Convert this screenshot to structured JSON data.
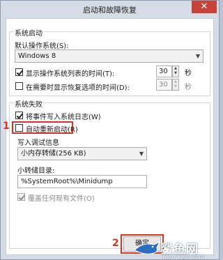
{
  "window": {
    "title": "启动和故障恢复",
    "close_icon": "close-icon"
  },
  "system_startup": {
    "group_title": "系统启动",
    "default_os_label": "默认操作系统(S):",
    "default_os_value": "Windows 8",
    "show_os_list_label": "显示操作系统列表的时间(T):",
    "show_os_list_checked": true,
    "show_os_list_value": "30",
    "show_os_list_unit": "秒",
    "show_recovery_label": "在需要时显示恢复选项的时间(D):",
    "show_recovery_checked": false,
    "show_recovery_value": "30",
    "show_recovery_unit": "秒"
  },
  "system_failure": {
    "group_title": "系统失败",
    "write_event_label": "将事件写入系统日志(W)",
    "write_event_checked": true,
    "auto_restart_label": "自动重新启动(R)",
    "auto_restart_checked": false,
    "debug_info": {
      "group_title": "写入调试信息",
      "dump_type": "小内存转储(256 KB)",
      "dump_dir_label": "小转储目录:",
      "dump_dir_value": "%SystemRoot%\\Minidump",
      "overwrite_label": "覆盖任何现有文件(O)",
      "overwrite_checked": true
    }
  },
  "annotations": {
    "marker_1": "1",
    "marker_2": "2",
    "color": "#e0311f"
  },
  "buttons": {
    "ok_label": "确定"
  },
  "watermark": {
    "text": "鲨鱼网",
    "url": "www.xajjn.com"
  }
}
